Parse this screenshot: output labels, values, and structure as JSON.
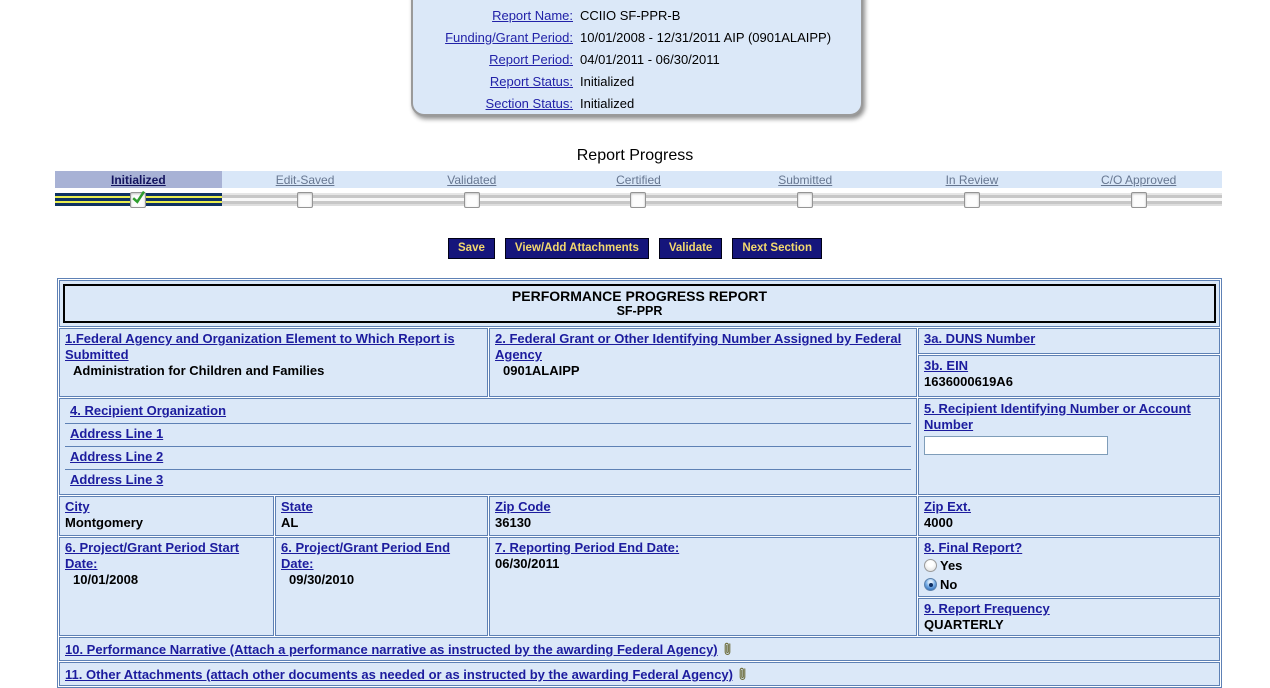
{
  "info_box": {
    "rows": [
      {
        "label": "Report Name:",
        "value": "CCIIO SF-PPR-B"
      },
      {
        "label": "Funding/Grant Period:",
        "value": "10/01/2008 - 12/31/2011 AIP (0901ALAIPP)"
      },
      {
        "label": "Report Period:",
        "value": "04/01/2011 - 06/30/2011"
      },
      {
        "label": "Report Status:",
        "value": "Initialized"
      },
      {
        "label": "Section Status:",
        "value": "Initialized"
      }
    ]
  },
  "progress": {
    "title": "Report Progress",
    "stages": [
      {
        "label": "Initialized",
        "active": true,
        "checked": true
      },
      {
        "label": "Edit-Saved",
        "active": false,
        "checked": false
      },
      {
        "label": "Validated",
        "active": false,
        "checked": false
      },
      {
        "label": "Certified",
        "active": false,
        "checked": false
      },
      {
        "label": "Submitted",
        "active": false,
        "checked": false
      },
      {
        "label": "In Review",
        "active": false,
        "checked": false
      },
      {
        "label": "C/O Approved",
        "active": false,
        "checked": false
      }
    ]
  },
  "toolbar": {
    "buttons": [
      "Save",
      "View/Add Attachments",
      "Validate",
      "Next Section"
    ]
  },
  "form": {
    "title": "PERFORMANCE PROGRESS REPORT",
    "subtitle": "SF-PPR",
    "fields": {
      "f1": {
        "label": "1.Federal Agency and Organization Element to Which Report is Submitted",
        "value": "Administration for Children and Families"
      },
      "f2": {
        "label": "2. Federal Grant or Other Identifying Number Assigned by Federal Agency",
        "value": "0901ALAIPP"
      },
      "f3a": {
        "label": "3a. DUNS Number",
        "value": ""
      },
      "f3b": {
        "label": "3b. EIN",
        "value": "1636000619A6"
      },
      "f4": {
        "label": "4. Recipient Organization"
      },
      "addr1": {
        "label": "Address Line 1"
      },
      "addr2": {
        "label": "Address Line 2"
      },
      "addr3": {
        "label": "Address Line 3"
      },
      "f5": {
        "label": "5. Recipient Identifying Number or Account Number",
        "input_value": ""
      },
      "city": {
        "label": "City",
        "value": "Montgomery"
      },
      "state": {
        "label": "State",
        "value": "AL"
      },
      "zip": {
        "label": "Zip Code",
        "value": "36130"
      },
      "zip_ext": {
        "label": "Zip Ext.",
        "value": "4000"
      },
      "f6_start": {
        "label": "6. Project/Grant Period Start Date:",
        "value": "10/01/2008"
      },
      "f6_end": {
        "label": "6. Project/Grant Period End Date:",
        "value": "09/30/2010"
      },
      "f7": {
        "label": "7. Reporting Period End Date:",
        "value": "06/30/2011"
      },
      "f8": {
        "label": "8. Final Report?",
        "options": [
          {
            "label": "Yes",
            "selected": false
          },
          {
            "label": "No",
            "selected": true
          }
        ]
      },
      "f9": {
        "label": "9. Report Frequency",
        "value": "QUARTERLY"
      },
      "f10": {
        "label": "10. Performance Narrative (Attach a performance narrative as instructed by the awarding Federal Agency)"
      },
      "f11": {
        "label": "11. Other Attachments (attach other documents as needed or as instructed by the awarding Federal Agency)"
      }
    }
  },
  "colors": {
    "cell_bg": "#dbe8f8",
    "table_border": "#5e81b5",
    "link": "#1c1c9e",
    "button_bg": "#15157b",
    "button_text": "#f2d86e",
    "active_stage_bg": "#a8b2d5",
    "done_bar": "#0e3263",
    "done_bar_stripe": "#e9ed4e",
    "check_green": "#2f9e2f"
  }
}
